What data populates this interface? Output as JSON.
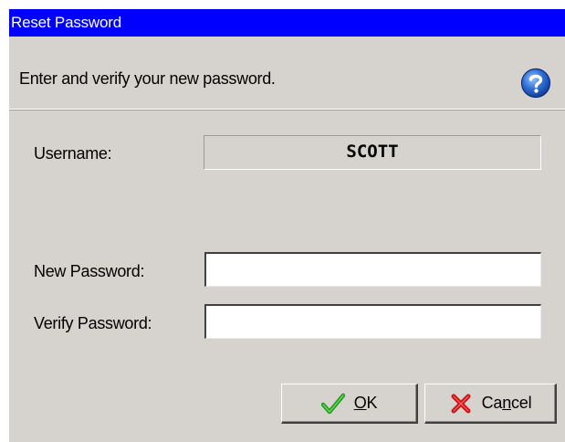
{
  "window": {
    "title": "Reset Password"
  },
  "header": {
    "instruction": "Enter and verify your new password.",
    "help_icon": "question-mark-help-icon"
  },
  "form": {
    "username_label": "Username:",
    "username_value": "SCOTT",
    "new_password_label": "New Password:",
    "new_password_value": "",
    "verify_password_label": "Verify Password:",
    "verify_password_value": ""
  },
  "buttons": {
    "ok": {
      "pre": "",
      "accel": "O",
      "post": "K",
      "icon": "green-checkmark-icon"
    },
    "cancel": {
      "pre": "Ca",
      "accel": "n",
      "post": "cel",
      "icon": "red-x-icon"
    }
  },
  "colors": {
    "titlebar_bg": "#0000ff",
    "titlebar_text": "#ffffff",
    "dialog_bg": "#d6d3ce",
    "help_icon_blue": "#2f6fd6",
    "ok_check_green": "#1e9e1e",
    "cancel_x_red": "#d01010"
  }
}
